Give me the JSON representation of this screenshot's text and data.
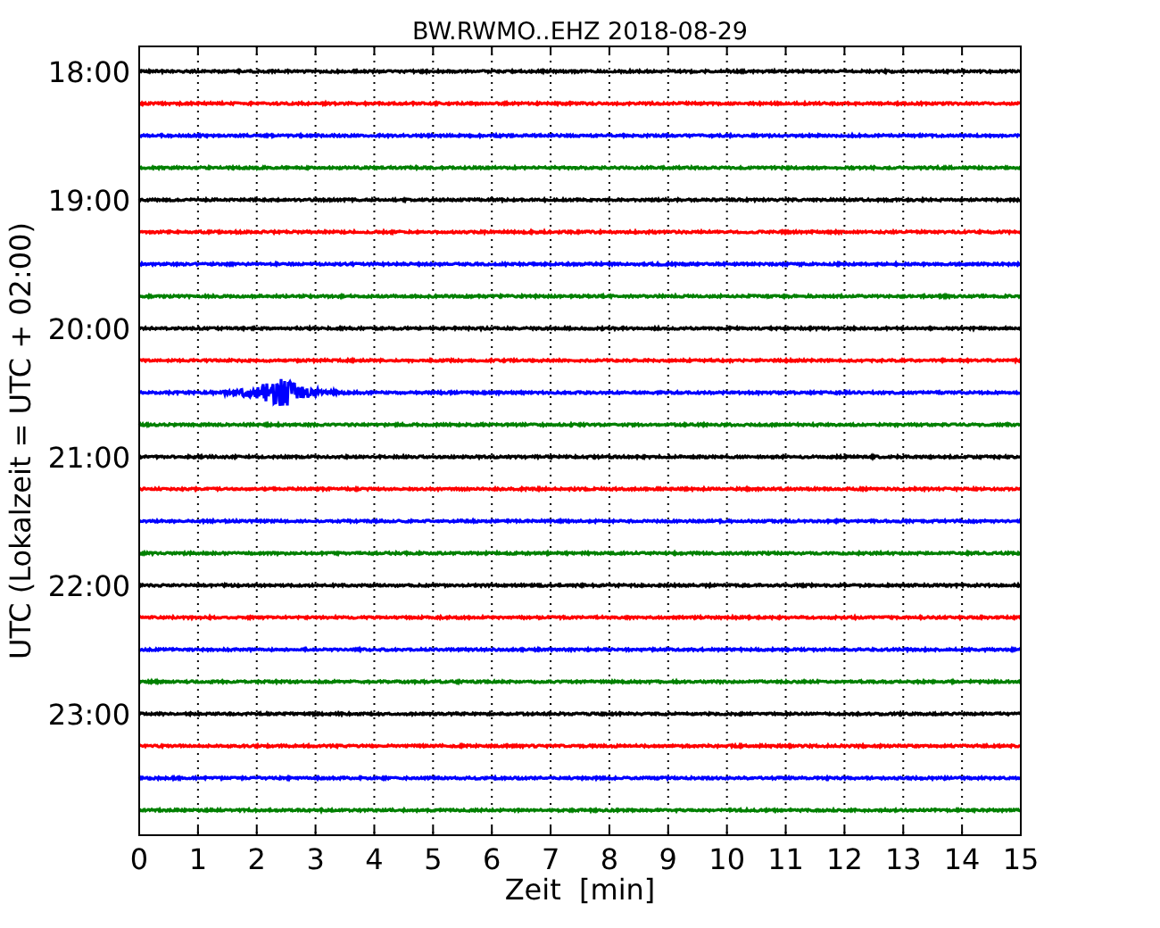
{
  "title": "BW.RWMO..EHZ 2018-08-29",
  "ylabel": "UTC (Lokalzeit = UTC + 02:00)",
  "xlabel": "Zeit  [min]",
  "xticks": [
    "0",
    "1",
    "2",
    "3",
    "4",
    "5",
    "6",
    "7",
    "8",
    "9",
    "10",
    "11",
    "12",
    "13",
    "14",
    "15"
  ],
  "yticks": [
    "18:00",
    "19:00",
    "20:00",
    "21:00",
    "22:00",
    "23:00"
  ],
  "traces": [
    {
      "color": "#000000",
      "kind": "quiet"
    },
    {
      "color": "#ff0000",
      "kind": "quiet"
    },
    {
      "color": "#0000ff",
      "kind": "quiet"
    },
    {
      "color": "#008000",
      "kind": "quiet"
    },
    {
      "color": "#000000",
      "kind": "quiet"
    },
    {
      "color": "#ff0000",
      "kind": "quiet"
    },
    {
      "color": "#0000ff",
      "kind": "quiet"
    },
    {
      "color": "#008000",
      "kind": "quiet"
    },
    {
      "color": "#000000",
      "kind": "quiet"
    },
    {
      "color": "#ff0000",
      "kind": "quiet"
    },
    {
      "color": "#0000ff",
      "kind": "event"
    },
    {
      "color": "#008000",
      "kind": "quiet"
    },
    {
      "color": "#000000",
      "kind": "quiet"
    },
    {
      "color": "#ff0000",
      "kind": "quiet"
    },
    {
      "color": "#0000ff",
      "kind": "quiet"
    },
    {
      "color": "#008000",
      "kind": "quiet"
    },
    {
      "color": "#000000",
      "kind": "quiet"
    },
    {
      "color": "#ff0000",
      "kind": "quiet"
    },
    {
      "color": "#0000ff",
      "kind": "quiet"
    },
    {
      "color": "#008000",
      "kind": "quiet"
    },
    {
      "color": "#000000",
      "kind": "quiet"
    },
    {
      "color": "#ff0000",
      "kind": "quiet"
    },
    {
      "color": "#0000ff",
      "kind": "quiet"
    },
    {
      "color": "#008000",
      "kind": "quiet"
    }
  ]
}
